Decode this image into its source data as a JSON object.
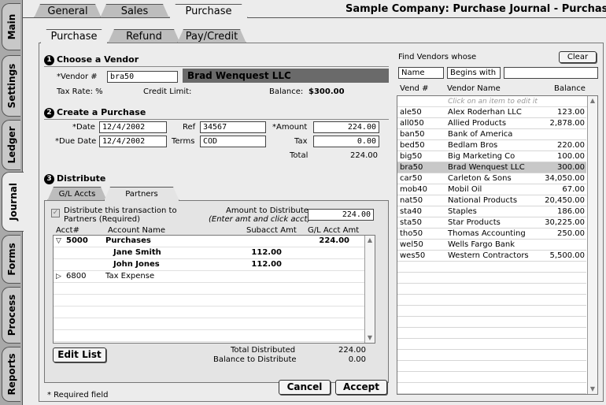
{
  "left_tabs": [
    "Main",
    "Settings",
    "Ledger",
    "Journal",
    "Forms",
    "Process",
    "Reports"
  ],
  "top_tabs": [
    "General",
    "Sales",
    "Purchase"
  ],
  "window_title": "Sample Company: Purchase Journal - Purchase",
  "sub_tabs": [
    "Purchase",
    "Refund",
    "Pay/Credit"
  ],
  "vendor_section": {
    "number": "1",
    "title": "Choose a Vendor",
    "vendor_label": "*Vendor #",
    "vendor_value": "bra50",
    "vendor_name": "Brad Wenquest LLC",
    "tax_rate": "Tax Rate: %",
    "credit_limit": "Credit Limit:",
    "balance_label": "Balance:",
    "balance_value": "$300.00"
  },
  "purchase_section": {
    "number": "2",
    "title": "Create a Purchase",
    "date_label": "*Date",
    "date_value": "12/4/2002",
    "ref_label": "Ref",
    "ref_value": "34567",
    "amount_label": "*Amount",
    "amount_value": "224.00",
    "due_label": "*Due Date",
    "due_value": "12/4/2002",
    "terms_label": "Terms",
    "terms_value": "COD",
    "tax_label": "Tax",
    "tax_value": "0.00",
    "total_label": "Total",
    "total_value": "224.00"
  },
  "distribute_section": {
    "number": "3",
    "title": "Distribute",
    "tabs": [
      "G/L Accts",
      "Partners"
    ],
    "checkbox_label": "Distribute this transaction to Partners (Required)",
    "atd_label": "Amount to Distribute",
    "atd_hint": "(Enter amt and click acct)",
    "atd_value": "224.00",
    "columns": [
      "Acct#",
      "Account Name",
      "Subacct Amt",
      "G/L Acct Amt"
    ],
    "rows": [
      {
        "acct": "5000",
        "name": "Purchases",
        "sub": "",
        "gl": "224.00",
        "bold": true,
        "expanded": true,
        "indent": false
      },
      {
        "acct": "",
        "name": "Jane Smith",
        "sub": "112.00",
        "gl": "",
        "bold": true,
        "expanded": null,
        "indent": true
      },
      {
        "acct": "",
        "name": "John Jones",
        "sub": "112.00",
        "gl": "",
        "bold": true,
        "expanded": null,
        "indent": true
      },
      {
        "acct": "6800",
        "name": "Tax Expense",
        "sub": "",
        "gl": "",
        "bold": false,
        "expanded": false,
        "indent": false
      }
    ],
    "edit_list": "Edit List",
    "total_distributed_label": "Total Distributed",
    "total_distributed_value": "224.00",
    "balance_to_distribute_label": "Balance to Distribute",
    "balance_to_distribute_value": "0.00"
  },
  "required_note": "* Required field",
  "buttons": {
    "cancel": "Cancel",
    "accept": "Accept",
    "clear": "Clear"
  },
  "find": {
    "label": "Find Vendors whose",
    "field": "Name",
    "op": "Begins with",
    "value": "",
    "columns": [
      "Vend #",
      "Vendor Name",
      "Balance"
    ],
    "hint": "Click on an item to edit it",
    "selected": "bra50",
    "vendors": [
      [
        "ale50",
        "Alex Roderhan LLC",
        "123.00"
      ],
      [
        "all050",
        "Allied Products",
        "2,878.00"
      ],
      [
        "ban50",
        "Bank of America",
        ""
      ],
      [
        "bed50",
        "Bedlam Bros",
        "220.00"
      ],
      [
        "big50",
        "Big Marketing Co",
        "100.00"
      ],
      [
        "bra50",
        "Brad Wenquest LLC",
        "300.00"
      ],
      [
        "car50",
        "Carleton & Sons",
        "34,050.00"
      ],
      [
        "mob40",
        "Mobil Oil",
        "67.00"
      ],
      [
        "nat50",
        "National Products",
        "20,450.00"
      ],
      [
        "sta40",
        "Staples",
        "186.00"
      ],
      [
        "sta50",
        "Star Products",
        "30,225.00"
      ],
      [
        "tho50",
        "Thomas Accounting",
        "250.00"
      ],
      [
        "wel50",
        "Wells Fargo Bank",
        ""
      ],
      [
        "wes50",
        "Western Contractors",
        "5,500.00"
      ]
    ]
  },
  "colors": {
    "vendor_banner": "#6a6a6a",
    "selected_row": "#c8c8c8"
  }
}
